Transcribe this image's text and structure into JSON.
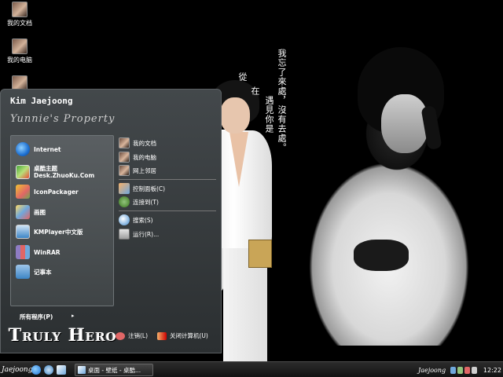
{
  "desktop": {
    "icons": [
      {
        "label": "我的文档",
        "icon": "my-documents-icon"
      },
      {
        "label": "我的电脑",
        "icon": "my-computer-icon"
      },
      {
        "label": "",
        "icon": "recycle-bin-icon"
      }
    ],
    "wallpaper": {
      "poem": [
        "我忘了來處，沒有去處。",
        "遇見你是",
        "在",
        "從"
      ]
    }
  },
  "start_menu": {
    "user_name": "Kim Jaejoong",
    "user_subtitle": "Yunnie's Property",
    "pinned": [
      {
        "label": "Internet",
        "icon": "internet-explorer-icon"
      },
      {
        "label": "桌酷主题",
        "sublabel": "Desk.ZhuoKu.Com",
        "icon": "theme-icon"
      },
      {
        "label": "IconPackager",
        "icon": "iconpackager-icon"
      },
      {
        "label": "画图",
        "icon": "paint-icon"
      },
      {
        "label": "KMPlayer中文版",
        "icon": "kmplayer-icon"
      },
      {
        "label": "WinRAR",
        "icon": "winrar-icon"
      },
      {
        "label": "记事本",
        "icon": "notepad-icon"
      }
    ],
    "all_programs": "所有程序(P)",
    "right_items": [
      {
        "label": "我的文档",
        "icon": "my-documents-icon"
      },
      {
        "label": "我的电脑",
        "icon": "my-computer-icon"
      },
      {
        "label": "网上邻居",
        "icon": "network-icon"
      },
      {
        "label": "控制面板(C)",
        "icon": "control-panel-icon"
      },
      {
        "label": "连接到(T)",
        "icon": "connect-to-icon"
      },
      {
        "label": "搜索(S)",
        "icon": "search-icon"
      },
      {
        "label": "运行(R)...",
        "icon": "run-icon"
      }
    ],
    "brand": "Truly Hero",
    "logoff": "注销(L)",
    "shutdown": "关闭计算机(U)"
  },
  "taskbar": {
    "start_label": "Jaejoong",
    "task": "桌面 - 壁纸 - 桌酷...",
    "tray_name": "Jaejoong",
    "clock": "12:22"
  }
}
